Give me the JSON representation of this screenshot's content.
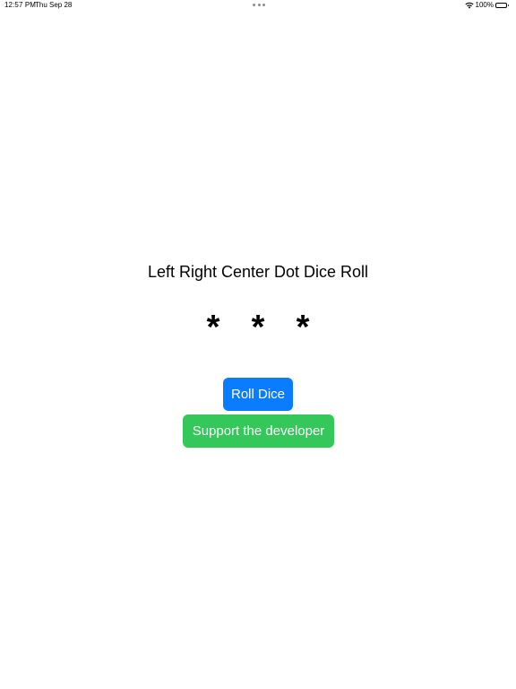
{
  "status_bar": {
    "time": "12:57 PM",
    "date": "Thu Sep 28",
    "battery_text": "100%",
    "battery_level": 1.0,
    "icons": [
      "more-dots-icon",
      "wifi-icon",
      "battery-icon"
    ]
  },
  "main": {
    "title": "Left Right Center Dot Dice Roll",
    "dice": [
      "*",
      "*",
      "*"
    ]
  },
  "buttons": {
    "roll_label": "Roll Dice",
    "support_label": "Support the developer"
  },
  "colors": {
    "roll_button": "#0a7cff",
    "support_button": "#34c759",
    "background": "#ffffff",
    "text": "#000000"
  }
}
